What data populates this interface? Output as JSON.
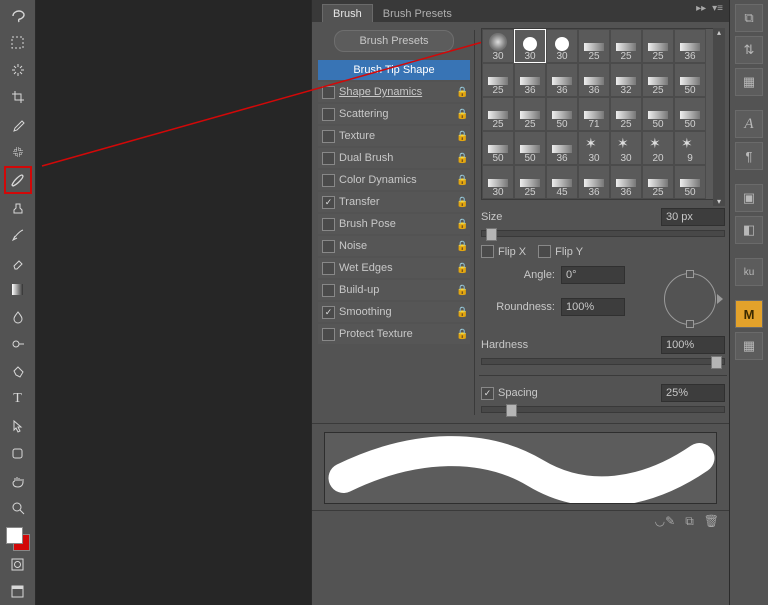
{
  "tabs": {
    "brush": "Brush",
    "presets": "Brush Presets"
  },
  "presets_button": "Brush Presets",
  "tip_shape_header": "Brush Tip Shape",
  "options": [
    {
      "label": "Shape Dynamics",
      "checked": false,
      "locked": true,
      "underline": true
    },
    {
      "label": "Scattering",
      "checked": false,
      "locked": true
    },
    {
      "label": "Texture",
      "checked": false,
      "locked": true
    },
    {
      "label": "Dual Brush",
      "checked": false,
      "locked": true
    },
    {
      "label": "Color Dynamics",
      "checked": false,
      "locked": true
    },
    {
      "label": "Transfer",
      "checked": true,
      "locked": true
    },
    {
      "label": "Brush Pose",
      "checked": false,
      "locked": true
    },
    {
      "label": "Noise",
      "checked": false,
      "locked": true
    },
    {
      "label": "Wet Edges",
      "checked": false,
      "locked": true
    },
    {
      "label": "Build-up",
      "checked": false,
      "locked": true
    },
    {
      "label": "Smoothing",
      "checked": true,
      "locked": true
    },
    {
      "label": "Protect Texture",
      "checked": false,
      "locked": true
    }
  ],
  "brush_sizes": [
    [
      "30",
      "30",
      "30",
      "25",
      "25",
      "25",
      "36"
    ],
    [
      "25",
      "36",
      "36",
      "36",
      "32",
      "25",
      "50"
    ],
    [
      "25",
      "25",
      "50",
      "71",
      "25",
      "50",
      "50"
    ],
    [
      "50",
      "50",
      "36",
      "30",
      "30",
      "20",
      "9"
    ],
    [
      "30",
      "25",
      "45",
      "36",
      "36",
      "25",
      "50"
    ]
  ],
  "selected_brush": {
    "row": 0,
    "col": 1
  },
  "fields": {
    "size_label": "Size",
    "size_value": "30 px",
    "flipx": "Flip X",
    "flipy": "Flip Y",
    "angle_label": "Angle:",
    "angle_value": "0°",
    "round_label": "Roundness:",
    "round_value": "100%",
    "hard_label": "Hardness",
    "hard_value": "100%",
    "spacing_label": "Spacing",
    "spacing_value": "25%",
    "spacing_checked": true
  },
  "dock_icons": [
    "grid",
    "swap",
    "pattern",
    "A",
    "¶",
    "",
    "cube",
    "3d",
    "ku",
    "",
    "M",
    "tiles"
  ]
}
